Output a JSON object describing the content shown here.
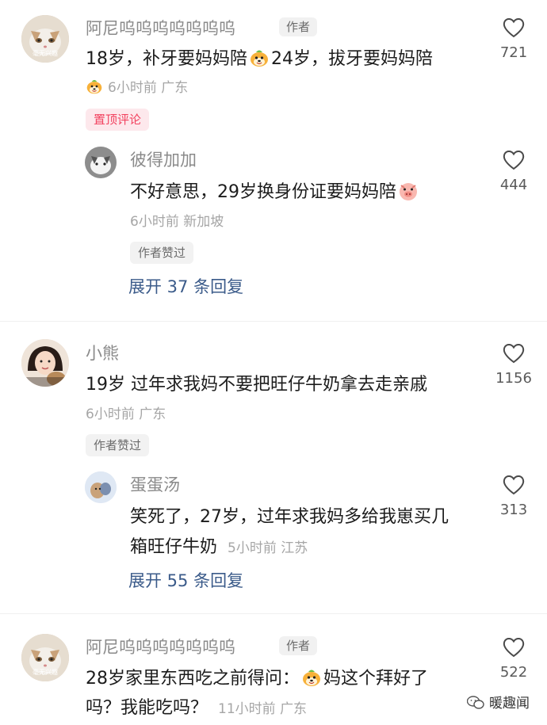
{
  "comments": [
    {
      "name": "阿尼呜呜呜呜呜呜呜",
      "author_tag": "作者",
      "avatar_label": "毫无兴趣",
      "text_parts": [
        "18岁，补牙要妈妈陪",
        "24岁，拔牙要妈妈陪"
      ],
      "time": "6小时前",
      "location": "广东",
      "pinned_label": "置顶评论",
      "likes": "721",
      "reply": {
        "name": "彼得加加",
        "text": "不好意思，29岁换身份证要妈妈陪",
        "time": "6小时前",
        "location": "新加坡",
        "author_liked": "作者赞过",
        "likes": "444"
      },
      "expand": "展开 37 条回复"
    },
    {
      "name": "小熊",
      "text": "19岁 过年求我妈不要把旺仔牛奶拿去走亲戚",
      "time": "6小时前",
      "location": "广东",
      "author_liked": "作者赞过",
      "likes": "1156",
      "reply": {
        "name": "蛋蛋汤",
        "text_line1": "笑死了，27岁，过年求我妈多给我崽买几",
        "text_line2": "箱旺仔牛奶",
        "time": "5小时前",
        "location": "江苏",
        "likes": "313"
      },
      "expand": "展开 55 条回复"
    },
    {
      "name": "阿尼呜呜呜呜呜呜呜",
      "author_tag": "作者",
      "avatar_label": "毫无兴趣",
      "text_line1_a": "28岁家里东西吃之前得问：",
      "text_line1_b": "妈这个拜好了",
      "text_line2": "吗？我能吃吗？",
      "time": "11小时前",
      "location": "广东",
      "likes": "522"
    }
  ],
  "watermark": "暖趣闻",
  "colors": {
    "pinned": "#f2425f",
    "expand_link": "#3b5b8a",
    "meta": "#a6a6a6"
  }
}
